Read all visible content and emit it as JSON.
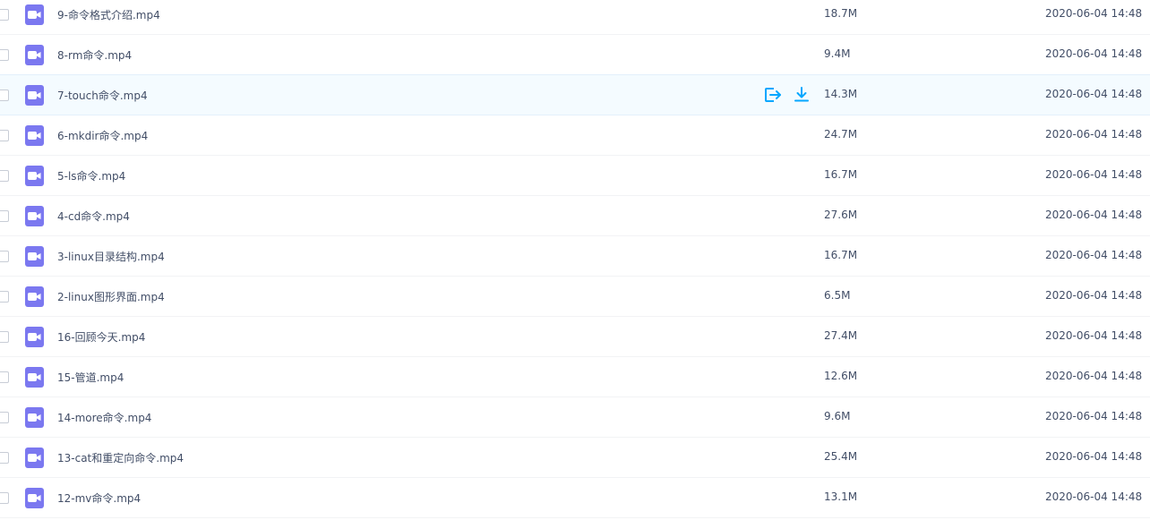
{
  "accent_color": "#06a7ff",
  "file_icon_color": "#7b78f0",
  "files": [
    {
      "name": "9-命令格式介绍.mp4",
      "size": "18.7M",
      "date": "2020-06-04 14:48",
      "icon": "video-file-icon"
    },
    {
      "name": "8-rm命令.mp4",
      "size": "9.4M",
      "date": "2020-06-04 14:48",
      "icon": "video-file-icon"
    },
    {
      "name": "7-touch命令.mp4",
      "size": "14.3M",
      "date": "2020-06-04 14:48",
      "icon": "video-file-icon",
      "hovered": true
    },
    {
      "name": "6-mkdir命令.mp4",
      "size": "24.7M",
      "date": "2020-06-04 14:48",
      "icon": "video-file-icon"
    },
    {
      "name": "5-ls命令.mp4",
      "size": "16.7M",
      "date": "2020-06-04 14:48",
      "icon": "video-file-icon"
    },
    {
      "name": "4-cd命令.mp4",
      "size": "27.6M",
      "date": "2020-06-04 14:48",
      "icon": "video-file-icon"
    },
    {
      "name": "3-linux目录结构.mp4",
      "size": "16.7M",
      "date": "2020-06-04 14:48",
      "icon": "video-file-icon"
    },
    {
      "name": "2-linux图形界面.mp4",
      "size": "6.5M",
      "date": "2020-06-04 14:48",
      "icon": "video-file-icon"
    },
    {
      "name": "16-回顾今天.mp4",
      "size": "27.4M",
      "date": "2020-06-04 14:48",
      "icon": "video-file-icon"
    },
    {
      "name": "15-管道.mp4",
      "size": "12.6M",
      "date": "2020-06-04 14:48",
      "icon": "video-file-icon"
    },
    {
      "name": "14-more命令.mp4",
      "size": "9.6M",
      "date": "2020-06-04 14:48",
      "icon": "video-file-icon"
    },
    {
      "name": "13-cat和重定向命令.mp4",
      "size": "25.4M",
      "date": "2020-06-04 14:48",
      "icon": "video-file-icon"
    },
    {
      "name": "12-mv命令.mp4",
      "size": "13.1M",
      "date": "2020-06-04 14:48",
      "icon": "video-file-icon"
    }
  ],
  "hover_actions": [
    {
      "icon": "share-icon"
    },
    {
      "icon": "download-icon"
    }
  ]
}
